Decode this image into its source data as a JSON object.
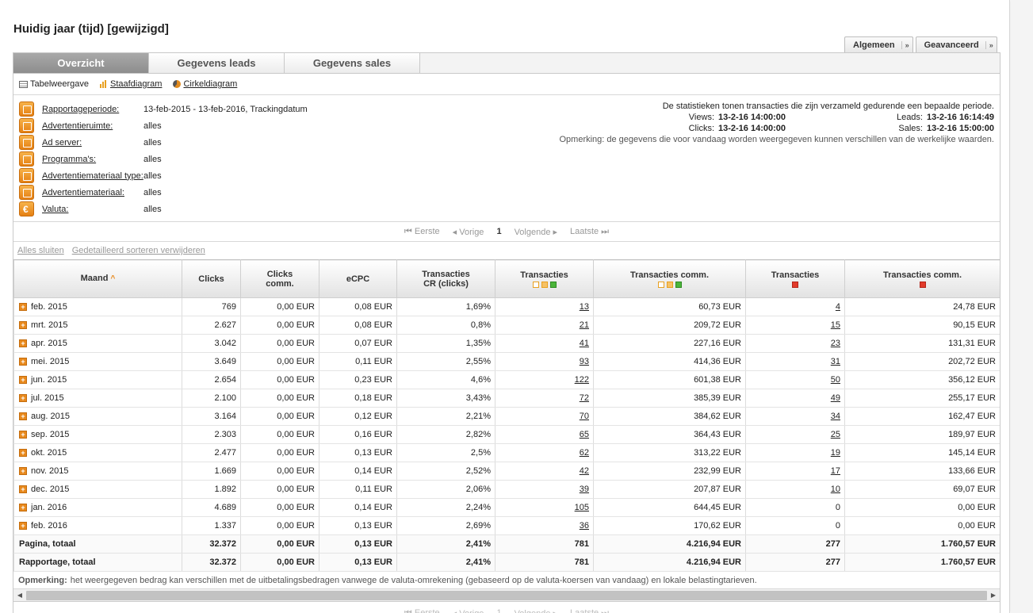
{
  "title": "Huidig jaar (tijd) [gewijzigd]",
  "view_buttons": [
    {
      "label": "Algemeen",
      "arrow": "»"
    },
    {
      "label": "Geavanceerd",
      "arrow": "»"
    }
  ],
  "tabs": [
    "Overzicht",
    "Gegevens leads",
    "Gegevens sales"
  ],
  "view_modes": {
    "table": "Tabelweergave",
    "bar": "Staafdiagram",
    "pie": "Cirkeldiagram"
  },
  "filters": [
    {
      "label": "Rapportageperiode:",
      "value": "13-feb-2015 - 13-feb-2016, Trackingdatum",
      "icon": "calendar-icon"
    },
    {
      "label": "Advertentieruimte:",
      "value": "alles",
      "icon": "adspace-icon"
    },
    {
      "label": "Ad server:",
      "value": "alles",
      "icon": "adserver-icon"
    },
    {
      "label": "Programma's:",
      "value": "alles",
      "icon": "programs-icon"
    },
    {
      "label": "Advertentiemateriaal type:",
      "value": "alles",
      "icon": "material-type-icon"
    },
    {
      "label": "Advertentiemateriaal:",
      "value": "alles",
      "icon": "material-icon"
    },
    {
      "label": "Valuta:",
      "value": "alles",
      "icon": "euro-icon"
    }
  ],
  "stats": {
    "intro": "De statistieken tonen transacties die zijn verzameld gedurende een bepaalde periode.",
    "views_label": "Views:",
    "views_value": "13-2-16 14:00:00",
    "leads_label": "Leads:",
    "leads_value": "13-2-16 16:14:49",
    "clicks_label": "Clicks:",
    "clicks_value": "13-2-16 14:00:00",
    "sales_label": "Sales:",
    "sales_value": "13-2-16 15:00:00",
    "note": "Opmerking: de gegevens die voor vandaag worden weergegeven kunnen verschillen van de werkelijke waarden."
  },
  "pager": {
    "first": "Eerste",
    "prev": "Vorige",
    "page": "1",
    "next": "Volgende",
    "last": "Laatste"
  },
  "actions": {
    "close_all": "Alles sluiten",
    "remove_sort": "Gedetailleerd sorteren verwijderen"
  },
  "table": {
    "headers": {
      "month": "Maand",
      "clicks": "Clicks",
      "clicks_comm_1": "Clicks",
      "clicks_comm_2": "comm.",
      "ecpc": "eCPC",
      "cr_1": "Transacties",
      "cr_2": "CR (clicks)",
      "trans_open": "Transacties",
      "trans_comm_open": "Transacties comm.",
      "trans_rejected": "Transacties",
      "trans_comm_rejected": "Transacties comm."
    },
    "rows": [
      {
        "month": "feb. 2015",
        "clicks": "769",
        "clicks_comm": "0,00 EUR",
        "ecpc": "0,08 EUR",
        "cr": "1,69%",
        "trans": "13",
        "trans_comm": "60,73 EUR",
        "rej": "4",
        "rej_comm": "24,78 EUR"
      },
      {
        "month": "mrt. 2015",
        "clicks": "2.627",
        "clicks_comm": "0,00 EUR",
        "ecpc": "0,08 EUR",
        "cr": "0,8%",
        "trans": "21",
        "trans_comm": "209,72 EUR",
        "rej": "15",
        "rej_comm": "90,15 EUR"
      },
      {
        "month": "apr. 2015",
        "clicks": "3.042",
        "clicks_comm": "0,00 EUR",
        "ecpc": "0,07 EUR",
        "cr": "1,35%",
        "trans": "41",
        "trans_comm": "227,16 EUR",
        "rej": "23",
        "rej_comm": "131,31 EUR"
      },
      {
        "month": "mei. 2015",
        "clicks": "3.649",
        "clicks_comm": "0,00 EUR",
        "ecpc": "0,11 EUR",
        "cr": "2,55%",
        "trans": "93",
        "trans_comm": "414,36 EUR",
        "rej": "31",
        "rej_comm": "202,72 EUR"
      },
      {
        "month": "jun. 2015",
        "clicks": "2.654",
        "clicks_comm": "0,00 EUR",
        "ecpc": "0,23 EUR",
        "cr": "4,6%",
        "trans": "122",
        "trans_comm": "601,38 EUR",
        "rej": "50",
        "rej_comm": "356,12 EUR"
      },
      {
        "month": "jul. 2015",
        "clicks": "2.100",
        "clicks_comm": "0,00 EUR",
        "ecpc": "0,18 EUR",
        "cr": "3,43%",
        "trans": "72",
        "trans_comm": "385,39 EUR",
        "rej": "49",
        "rej_comm": "255,17 EUR"
      },
      {
        "month": "aug. 2015",
        "clicks": "3.164",
        "clicks_comm": "0,00 EUR",
        "ecpc": "0,12 EUR",
        "cr": "2,21%",
        "trans": "70",
        "trans_comm": "384,62 EUR",
        "rej": "34",
        "rej_comm": "162,47 EUR"
      },
      {
        "month": "sep. 2015",
        "clicks": "2.303",
        "clicks_comm": "0,00 EUR",
        "ecpc": "0,16 EUR",
        "cr": "2,82%",
        "trans": "65",
        "trans_comm": "364,43 EUR",
        "rej": "25",
        "rej_comm": "189,97 EUR"
      },
      {
        "month": "okt. 2015",
        "clicks": "2.477",
        "clicks_comm": "0,00 EUR",
        "ecpc": "0,13 EUR",
        "cr": "2,5%",
        "trans": "62",
        "trans_comm": "313,22 EUR",
        "rej": "19",
        "rej_comm": "145,14 EUR"
      },
      {
        "month": "nov. 2015",
        "clicks": "1.669",
        "clicks_comm": "0,00 EUR",
        "ecpc": "0,14 EUR",
        "cr": "2,52%",
        "trans": "42",
        "trans_comm": "232,99 EUR",
        "rej": "17",
        "rej_comm": "133,66 EUR"
      },
      {
        "month": "dec. 2015",
        "clicks": "1.892",
        "clicks_comm": "0,00 EUR",
        "ecpc": "0,11 EUR",
        "cr": "2,06%",
        "trans": "39",
        "trans_comm": "207,87 EUR",
        "rej": "10",
        "rej_comm": "69,07 EUR"
      },
      {
        "month": "jan. 2016",
        "clicks": "4.689",
        "clicks_comm": "0,00 EUR",
        "ecpc": "0,14 EUR",
        "cr": "2,24%",
        "trans": "105",
        "trans_comm": "644,45 EUR",
        "rej": "0",
        "rej_comm": "0,00 EUR"
      },
      {
        "month": "feb. 2016",
        "clicks": "1.337",
        "clicks_comm": "0,00 EUR",
        "ecpc": "0,13 EUR",
        "cr": "2,69%",
        "trans": "36",
        "trans_comm": "170,62 EUR",
        "rej": "0",
        "rej_comm": "0,00 EUR"
      }
    ],
    "totals": [
      {
        "month": "Pagina, totaal",
        "clicks": "32.372",
        "clicks_comm": "0,00 EUR",
        "ecpc": "0,13 EUR",
        "cr": "2,41%",
        "trans": "781",
        "trans_comm": "4.216,94 EUR",
        "rej": "277",
        "rej_comm": "1.760,57 EUR"
      },
      {
        "month": "Rapportage, totaal",
        "clicks": "32.372",
        "clicks_comm": "0,00 EUR",
        "ecpc": "0,13 EUR",
        "cr": "2,41%",
        "trans": "781",
        "trans_comm": "4.216,94 EUR",
        "rej": "277",
        "rej_comm": "1.760,57 EUR"
      }
    ]
  },
  "remark": {
    "label": "Opmerking:",
    "text": "het weergegeven bedrag kan verschillen met de uitbetalingsbedragen vanwege de valuta-omrekening (gebaseerd op de valuta-koersen van vandaag) en lokale belastingtarieven."
  }
}
